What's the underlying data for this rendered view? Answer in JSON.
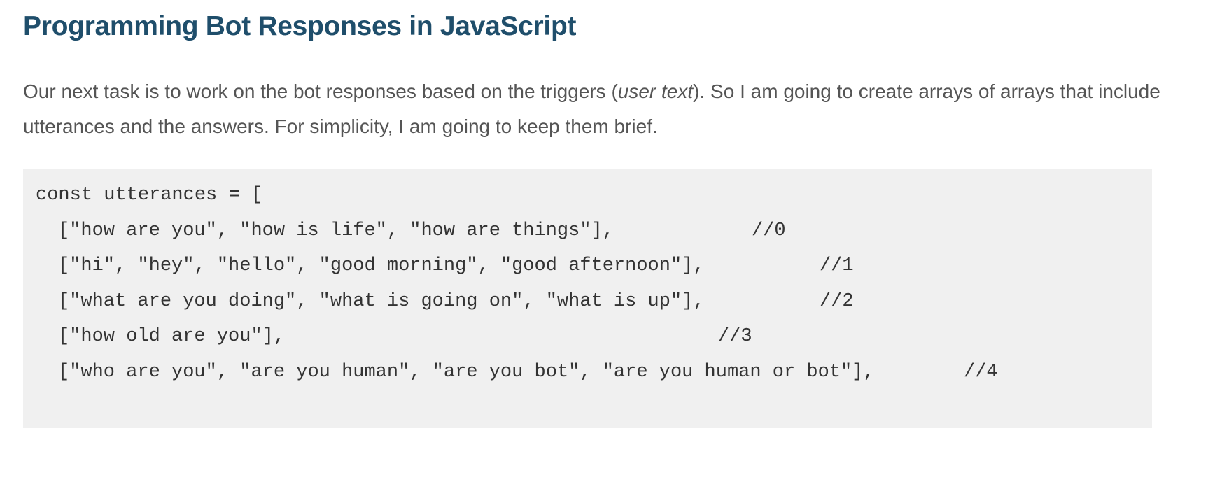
{
  "heading": "Programming Bot Responses in JavaScript",
  "intro": {
    "before_italic": "Our next task is to work on the bot responses based on the triggers (",
    "italic": "user text",
    "after_italic": "). So I am going to create arrays of arrays that include utterances and the answers. For simplicity, I am going to keep them brief."
  },
  "code": {
    "lines": [
      {
        "code": "const utterances = [",
        "comment": ""
      },
      {
        "code": "[\"how are you\", \"how is life\", \"how are things\"],",
        "comment": "//0"
      },
      {
        "code": "[\"hi\", \"hey\", \"hello\", \"good morning\", \"good afternoon\"],",
        "comment": "//1"
      },
      {
        "code": "[\"what are you doing\", \"what is going on\", \"what is up\"],",
        "comment": "//2"
      },
      {
        "code": "[\"how old are you\"],",
        "comment": "//3"
      },
      {
        "code": "[\"who are you\", \"are you human\", \"are you bot\", \"are you human or bot\"],",
        "comment": "//4"
      }
    ]
  }
}
